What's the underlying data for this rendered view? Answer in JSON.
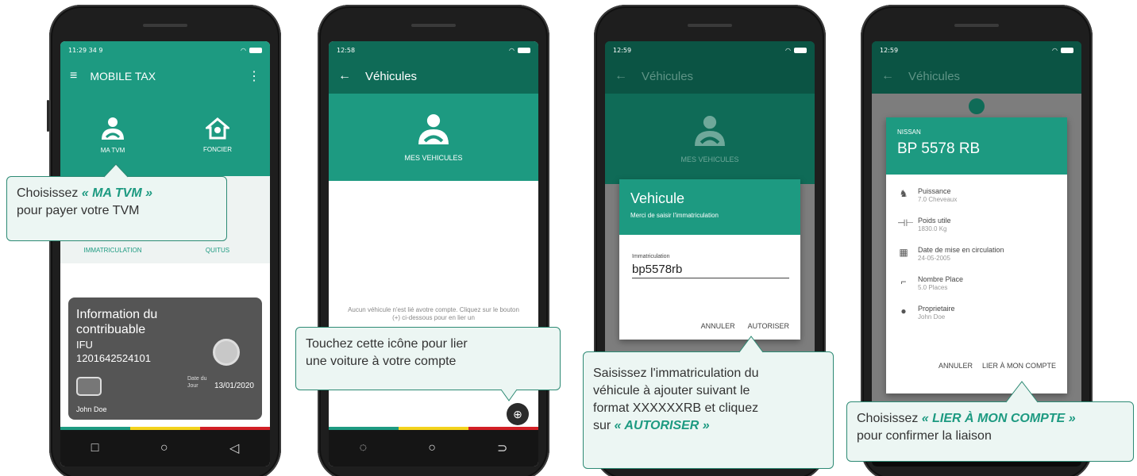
{
  "phone1": {
    "status_time": "11:29 34 9",
    "title": "MOBILE TAX",
    "tiles": [
      "MA TVM",
      "FONCIER",
      "IMMATRICULATION",
      "QUITUS"
    ],
    "card": {
      "title_line1": "Information du",
      "title_line2": "contribuable",
      "ifu_label": "IFU",
      "ifu": "1201642524101",
      "date_label_1": "Date du",
      "date_label_2": "Jour",
      "date": "13/01/2020",
      "name": "John Doe"
    },
    "nav": [
      "□",
      "○",
      "◁"
    ]
  },
  "phone2": {
    "status_time": "12:58",
    "title": "Véhicules",
    "hero_label": "MES VEHICULES",
    "empty_text": "Aucun véhicule n'est lié avotre compte. Cliquez sur le bouton (+) ci-dessous pour en lier un",
    "nav": [
      "◌",
      "○",
      "⊃"
    ]
  },
  "phone3": {
    "status_time": "12:59",
    "title": "Véhicules",
    "hero_label": "MES VEHICULES",
    "dialog": {
      "title": "Vehicule",
      "subtitle": "Merci de saisir l'immatriculation",
      "field_label": "Immatriculation",
      "field_value": "bp5578rb",
      "cancel": "ANNULER",
      "confirm": "AUTORISER"
    }
  },
  "phone4": {
    "status_time": "12:59",
    "title": "Véhicules",
    "vehicle": {
      "make": "NISSAN",
      "plate": "BP 5578 RB",
      "rows": [
        {
          "label": "Puissance",
          "value": "7.0 Cheveaux"
        },
        {
          "label": "Poids utile",
          "value": "1830.0 Kg"
        },
        {
          "label": "Date de mise en circulation",
          "value": "24-05-2005"
        },
        {
          "label": "Nombre Place",
          "value": "5.0 Places"
        },
        {
          "label": "Proprietaire",
          "value": "John Doe"
        }
      ],
      "cancel": "ANNULER",
      "confirm": "LIER À MON COMPTE"
    }
  },
  "callouts": {
    "c1": {
      "pre": "Choisissez ",
      "em": "« MA TVM »",
      "post": "pour payer votre TVM"
    },
    "c2": {
      "line1": "Touchez cette icône pour lier",
      "line2": "une voiture à votre compte"
    },
    "c3": {
      "line1": "Saisissez l'immatriculation du",
      "line2": "véhicule à ajouter suivant le",
      "line3": "format XXXXXXRB et cliquez",
      "pre4": "sur ",
      "em4": "« AUTORISER »"
    },
    "c4": {
      "pre": "Choisissez ",
      "em": "« LIER À MON COMPTE »",
      "post": "pour confirmer la liaison"
    }
  },
  "colors": {
    "primary": "#1d9a81",
    "dark": "#0f6b57",
    "flag_green": "#1d9a81",
    "flag_yellow": "#f3d21c",
    "flag_red": "#d21f26"
  }
}
